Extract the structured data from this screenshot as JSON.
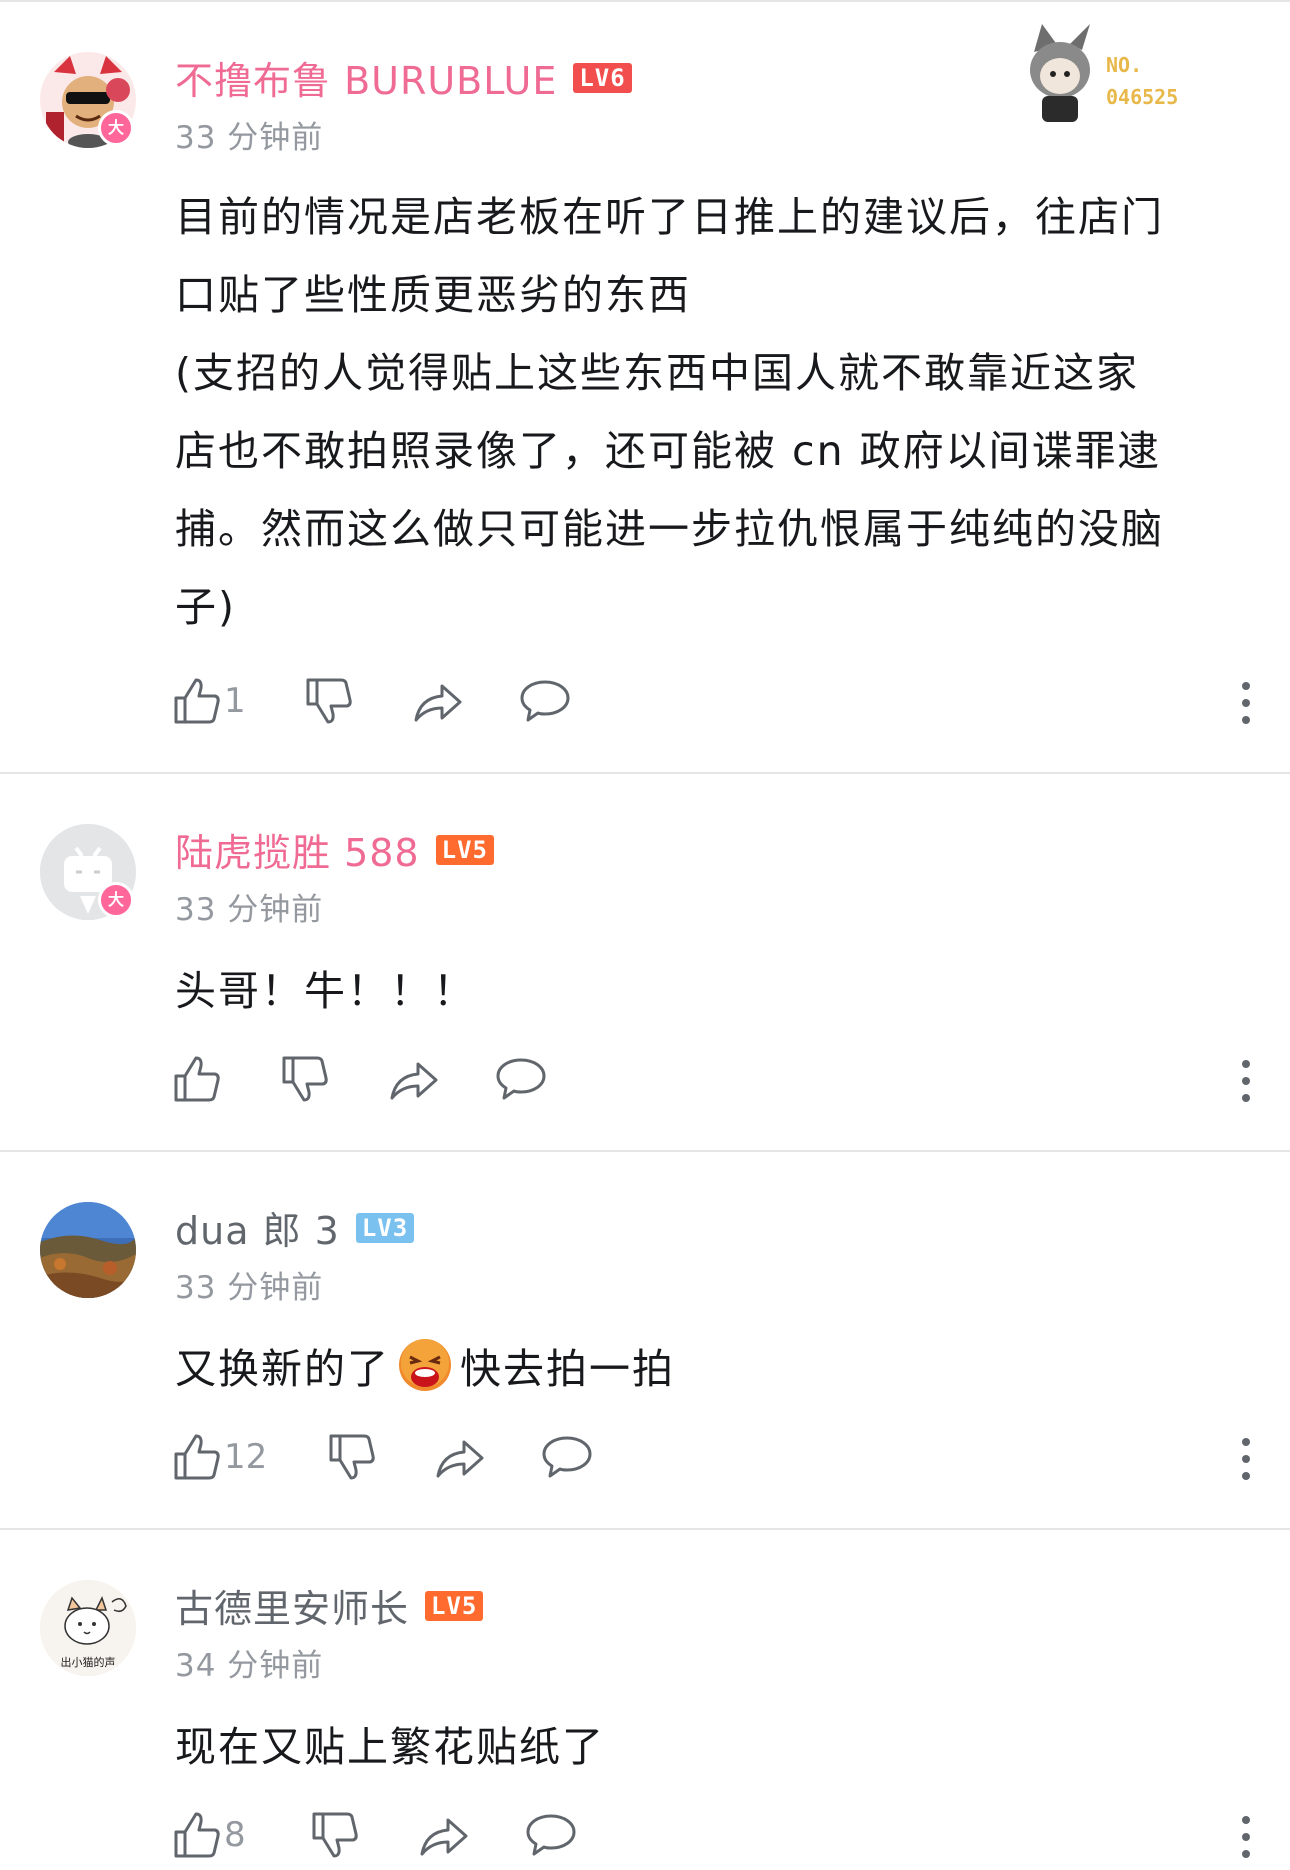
{
  "comments": [
    {
      "username": "不撸布鲁 BURUBLUE",
      "level": "LV6",
      "level_color": "#f24e4e",
      "time": "33 分钟前",
      "member_badge": "大",
      "name_color": "#f06b94",
      "content_lines": [
        "目前的情况是店老板在听了日推上的建议后，往店门",
        "口贴了些性质更恶劣的东西",
        "(支招的人觉得贴上这些东西中国人就不敢靠近这家",
        "店也不敢拍照录像了，还可能被 cn 政府以间谍罪逮",
        "捕。然而这么做只可能进一步拉仇恨属于纯纯的没脑",
        "子)"
      ],
      "likes": "1",
      "decoration": {
        "label": "NO.",
        "number": "046525"
      }
    },
    {
      "username": "陆虎揽胜 588",
      "level": "LV5",
      "level_color": "#ff6a2f",
      "time": "33 分钟前",
      "member_badge": "大",
      "name_color": "#f06b94",
      "content": "头哥！牛！！！",
      "likes": ""
    },
    {
      "username": "dua 郎 3",
      "level": "LV3",
      "level_color": "#7bc1f0",
      "time": "33 分钟前",
      "name_color": "#61666d",
      "content_before": "又换新的了",
      "content_emoji": "laughing-emoji",
      "content_after": "快去拍一拍",
      "likes": "12"
    },
    {
      "username": "古德里安师长",
      "level": "LV5",
      "level_color": "#ff6a2f",
      "time": "34 分钟前",
      "name_color": "#61666d",
      "avatar_text": "出小猫的声",
      "content": "现在又贴上繁花贴纸了",
      "likes": "8"
    }
  ],
  "icons": {
    "like": "thumbs-up-icon",
    "dislike": "thumbs-down-icon",
    "share": "share-arrow-icon",
    "reply": "speech-bubble-icon",
    "more": "vertical-dots-icon"
  }
}
